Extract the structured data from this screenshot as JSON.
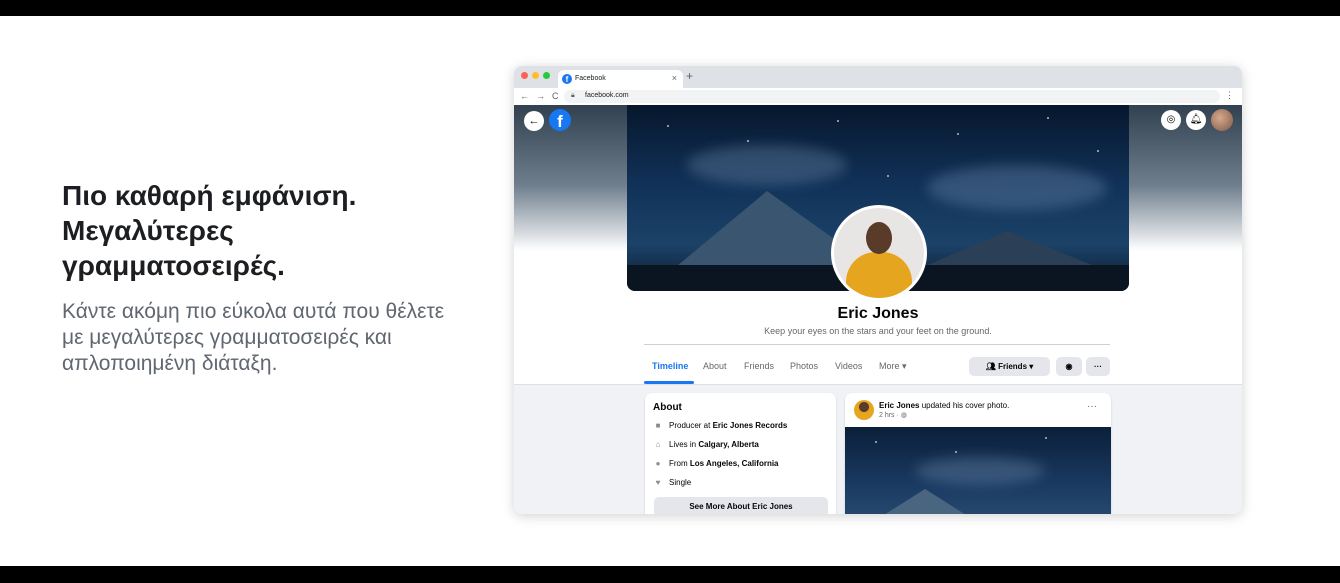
{
  "marketing": {
    "headline": "Πιο καθαρή εμφάνιση. Μεγαλύτερες γραμματοσειρές.",
    "subcopy": "Κάντε ακόμη πιο εύκολα αυτά που θέλετε με μεγαλύτερες γραμματοσειρές και απλοποιημένη διάταξη."
  },
  "browser": {
    "tab_title": "Facebook",
    "tab_close": "×",
    "new_tab": "+",
    "url": "facebook.com",
    "back": "←",
    "forward": "→",
    "reload": "C",
    "menu": "⋮",
    "dot_colors": [
      "#ff5f57",
      "#febc2e",
      "#28c840"
    ]
  },
  "facebook": {
    "logo": "f",
    "back_arrow": "←",
    "profile": {
      "name": "Eric Jones",
      "bio": "Keep your eyes on the stars and your feet on the ground."
    },
    "tabs": [
      "Timeline",
      "About",
      "Friends",
      "Photos",
      "Videos",
      "More ▾"
    ],
    "active_tab": "Timeline",
    "friends_button": "Friends ▾",
    "more_button": "···",
    "about": {
      "title": "About",
      "rows": [
        {
          "prefix": "Producer at ",
          "bold": "Eric Jones Records",
          "icon": "briefcase-icon"
        },
        {
          "prefix": "Lives in ",
          "bold": "Calgary, Alberta",
          "icon": "home-icon"
        },
        {
          "prefix": "From ",
          "bold": "Los Angeles, California",
          "icon": "location-pin-icon"
        },
        {
          "prefix": "",
          "bold": "",
          "text": "Single",
          "icon": "heart-icon"
        }
      ],
      "see_more": "See More About Eric Jones"
    },
    "post": {
      "author": "Eric Jones",
      "action": " updated his cover photo.",
      "time": "2 hrs · ",
      "globe": "◍",
      "menu": "···"
    },
    "accent_color": "#1877f2"
  }
}
